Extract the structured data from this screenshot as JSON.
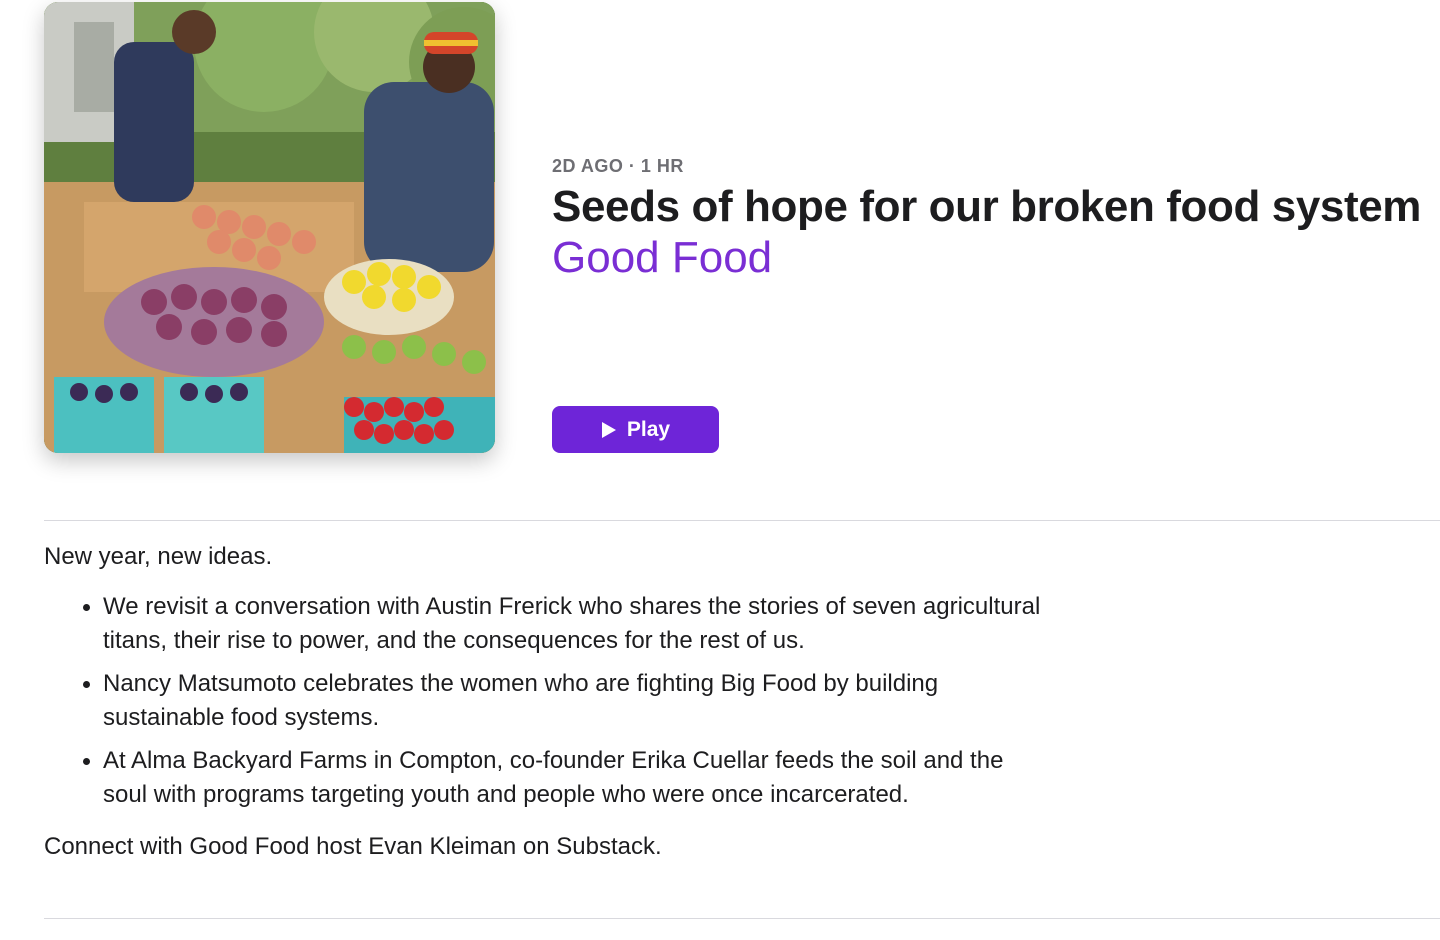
{
  "episode": {
    "meta": "2D AGO · 1 HR",
    "title": "Seeds of hope for our broken food system",
    "show_name": "Good Food",
    "play_label": "Play",
    "artwork_icon": "farmers-market-artwork"
  },
  "description": {
    "intro": "New year, new ideas.",
    "bullets": [
      "We revisit a conversation with Austin Frerick who shares the stories of seven agricultural titans, their rise to power, and the consequences for the rest of us.",
      "Nancy Matsumoto celebrates the women who are fighting Big Food by building sustainable food systems.",
      "At Alma Backyard Farms in Compton, co-founder Erika Cuellar feeds the soil and the soul with programs targeting youth and people who were once incarcerated."
    ],
    "outro": "Connect with Good Food host Evan Kleiman on Substack."
  },
  "colors": {
    "accent": "#7a2ed4",
    "play_button": "#6e25d8",
    "meta_text": "#6e6e73",
    "divider": "#d9d9de"
  }
}
